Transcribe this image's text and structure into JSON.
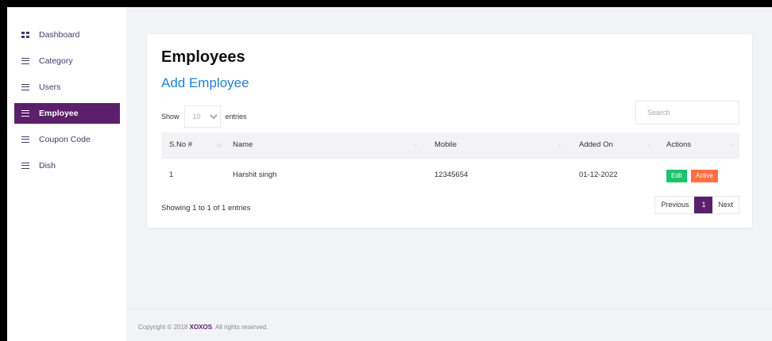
{
  "sidebar": {
    "items": [
      {
        "label": "Dashboard",
        "icon": "dashboard-icon"
      },
      {
        "label": "Category",
        "icon": "menu-icon"
      },
      {
        "label": "Users",
        "icon": "menu-icon"
      },
      {
        "label": "Employee",
        "icon": "menu-icon",
        "active": true
      },
      {
        "label": "Coupon Code",
        "icon": "menu-icon"
      },
      {
        "label": "Dish",
        "icon": "menu-icon"
      }
    ]
  },
  "page": {
    "title": "Employees",
    "add_link": "Add Employee"
  },
  "table_controls": {
    "show_label": "Show",
    "entries_value": "10",
    "entries_label": "entries",
    "search_placeholder": "Search"
  },
  "table": {
    "columns": [
      "S.No #",
      "Name",
      "Mobile",
      "Added On",
      "Actions"
    ],
    "rows": [
      {
        "sno": "1",
        "name": "Harshit singh",
        "mobile": "12345654",
        "added_on": "01-12-2022",
        "edit_label": "Edit",
        "status_label": "Active"
      }
    ]
  },
  "pagination": {
    "info": "Showing 1 to 1 of 1 entries",
    "previous": "Previous",
    "current": "1",
    "next": "Next"
  },
  "footer": {
    "prefix": "Copyright © 2018",
    "brand": "XOXOS",
    "suffix": ". All rights reserved."
  },
  "colors": {
    "accent": "#5c1f6b",
    "link": "#1a82d4",
    "edit": "#1fc16b",
    "active": "#ff7043"
  }
}
